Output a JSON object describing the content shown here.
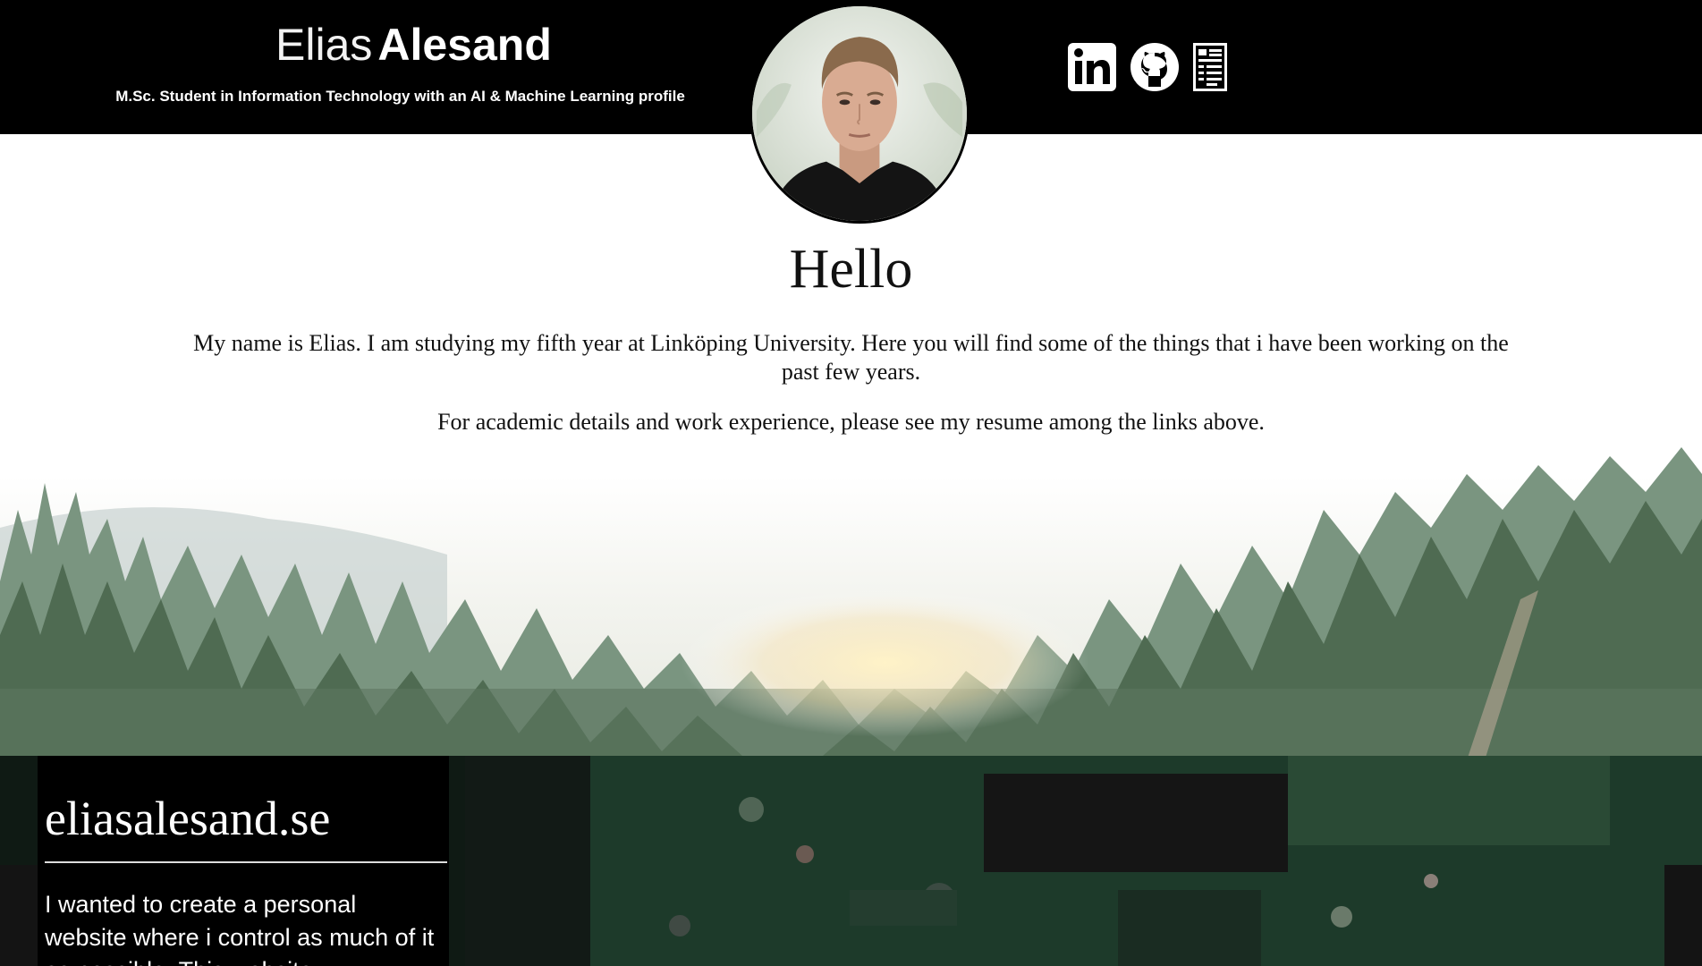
{
  "header": {
    "first_name": "Elias",
    "last_name": "Alesand",
    "subtitle": "M.Sc. Student in Information Technology with an AI & Machine Learning profile",
    "links": [
      {
        "name": "linkedin",
        "icon": "linkedin-icon"
      },
      {
        "name": "github",
        "icon": "github-icon"
      },
      {
        "name": "resume",
        "icon": "resume-document-icon"
      }
    ]
  },
  "hero": {
    "heading": "Hello",
    "intro": "My name is Elias. I am studying my fifth year at Linköping University. Here you will find some of the things that i have been working on the past few years.",
    "resume_note": "For academic details and work experience, please see my resume among the links above."
  },
  "project": {
    "title": "eliasalesand.se",
    "description": "I wanted to create a personal website where i control as much of it as possible. This website"
  },
  "colors": {
    "header_bg": "#000000",
    "text_dark": "#111111",
    "forest": "#4f6b52",
    "card_bg": "#000000"
  }
}
